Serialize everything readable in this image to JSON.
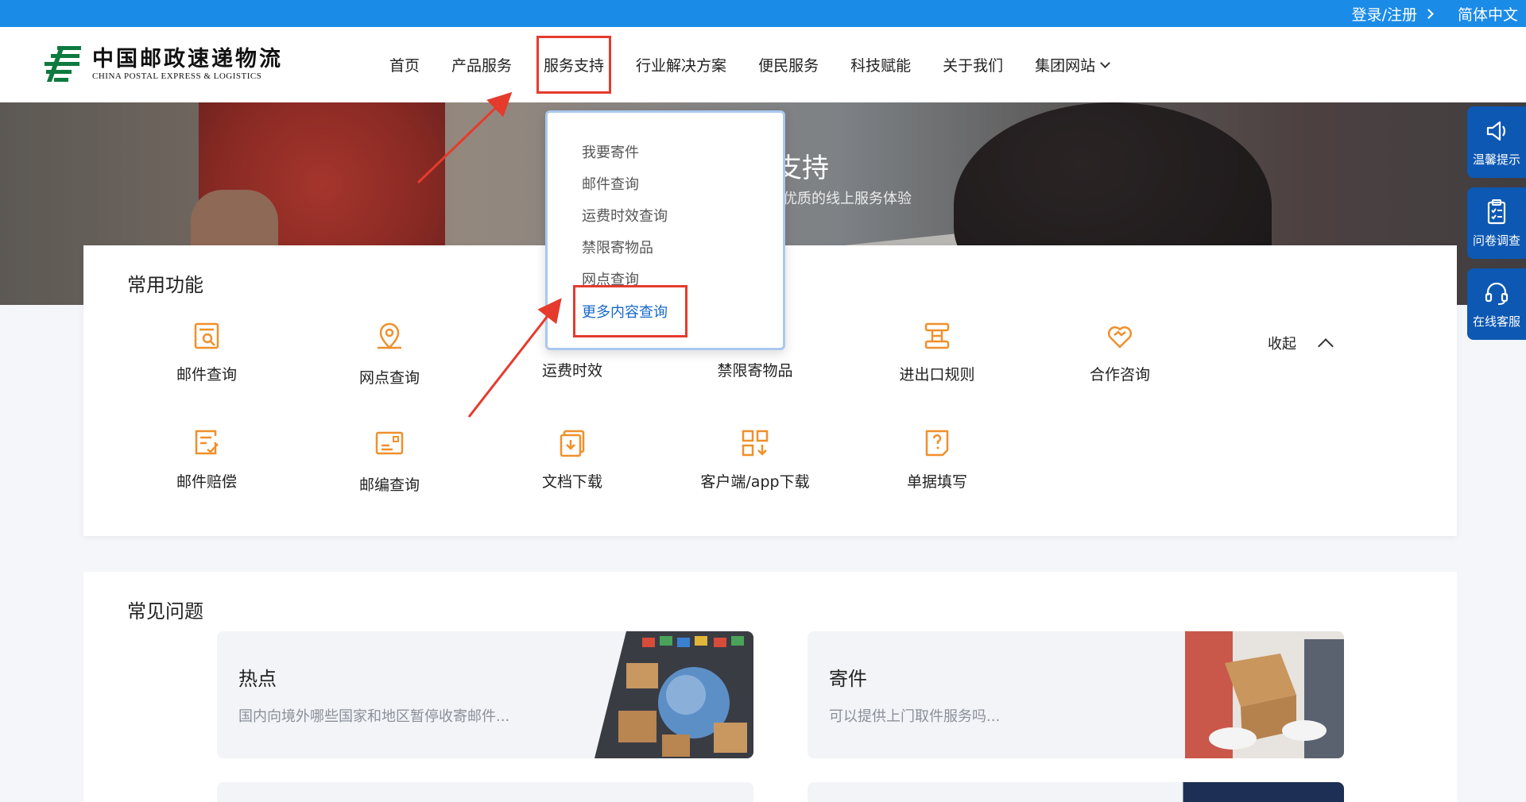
{
  "topbar": {
    "login": "登录/注册",
    "language": "简体中文"
  },
  "logo": {
    "cn": "中国邮政速递物流",
    "en": "CHINA POSTAL EXPRESS & LOGISTICS"
  },
  "nav": [
    "首页",
    "产品服务",
    "服务支持",
    "行业解决方案",
    "便民服务",
    "科技赋能",
    "关于我们",
    "集团网站"
  ],
  "banner": {
    "title": "支持",
    "subtitle": "优质的线上服务体验"
  },
  "dropdown": [
    "我要寄件",
    "邮件查询",
    "运费时效查询",
    "禁限寄物品",
    "网点查询",
    "更多内容查询"
  ],
  "side": [
    "温馨提示",
    "问卷调查",
    "在线客服"
  ],
  "common": {
    "title": "常用功能",
    "collapse": "收起",
    "row1": [
      "邮件查询",
      "网点查询",
      "运费时效",
      "禁限寄物品",
      "进出口规则",
      "合作咨询"
    ],
    "row2": [
      "邮件赔偿",
      "邮编查询",
      "文档下载",
      "客户端/app下载",
      "单据填写"
    ]
  },
  "faq": {
    "title": "常见问题",
    "cards": [
      {
        "title": "热点",
        "desc": "国内向境外哪些国家和地区暂停收寄邮件..."
      },
      {
        "title": "寄件",
        "desc": "可以提供上门取件服务吗..."
      }
    ]
  },
  "colors": {
    "topbar": "#1b8be8",
    "accent": "#f0902a",
    "highlight": "#e53b2d",
    "sidebar": "#0d58b3",
    "link": "#1668c8"
  }
}
